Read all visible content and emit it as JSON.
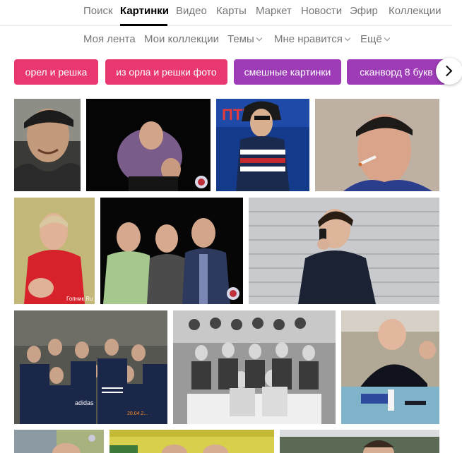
{
  "top_nav": {
    "items": [
      "Поиск",
      "Картинки",
      "Видео",
      "Карты",
      "Маркет",
      "Новости",
      "Эфир",
      "Коллекции"
    ],
    "active": "Картинки"
  },
  "sub_nav": {
    "feed": "Моя лента",
    "my_collections": "Мои коллекции",
    "themes": "Темы",
    "likes": "Мне нравится",
    "more": "Ещё"
  },
  "suggestions": [
    "орел и решка",
    "из орла и решки фото",
    "смешные картинки",
    "сканворд 8 букв"
  ],
  "colors": {
    "chip_pink": "#e8386f",
    "chip_purple": "#9e3cb7"
  },
  "icons": {
    "next": "chevron-right-icon",
    "dropdown": "chevron-down-icon"
  },
  "images": {
    "watermark_gopnik": "Гопник.Ru",
    "poster_text": "ПТУ",
    "jacket_brand": "adidas",
    "photo_date": "20.04.2..."
  }
}
